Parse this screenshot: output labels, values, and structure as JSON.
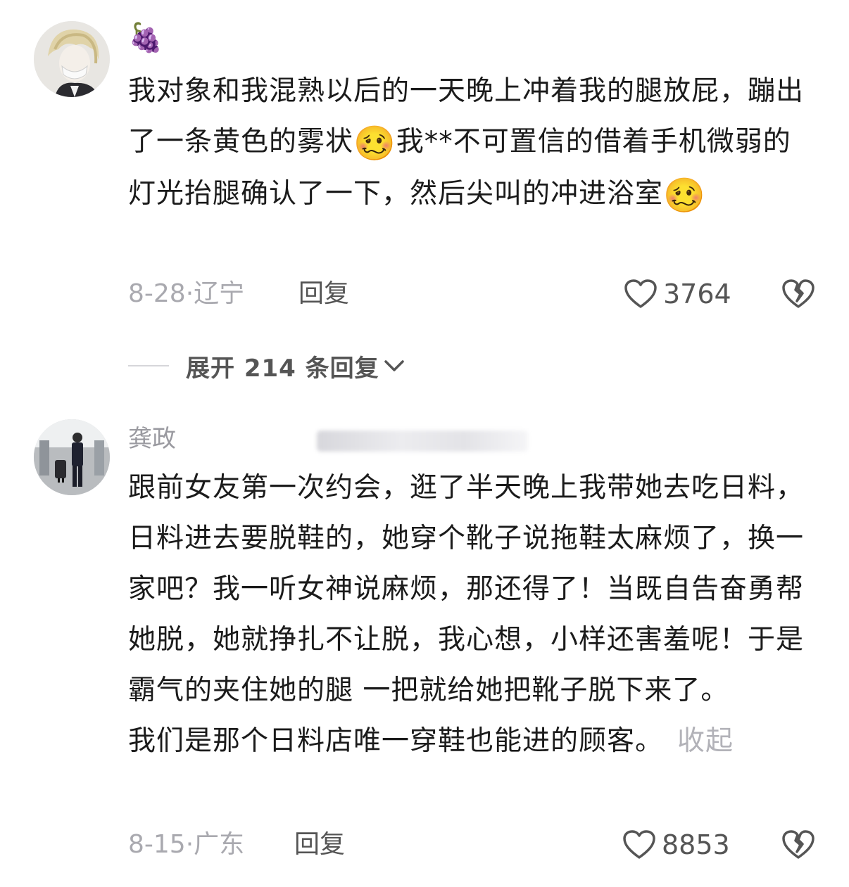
{
  "comments": [
    {
      "username": "",
      "badge_emoji": "🍇",
      "text_part1": "我对象和我混熟以后的一天晚上冲着我的腿放屁，蹦出了一条黄色的雾状",
      "emoji_inline": "🥴",
      "text_part2": "我**不可置信的借着手机微弱的灯光抬腿确认了一下，然后尖叫的冲进浴室",
      "emoji_end": "🥴",
      "time_location": "8-28·辽宁",
      "reply_label": "回复",
      "like_count": "3764",
      "expand_label": "展开 214 条回复"
    },
    {
      "username": "龚政",
      "text_main": "跟前女友第一次约会，逛了半天晚上我带她去吃日料，日料进去要脱鞋的，她穿个靴子说拖鞋太麻烦了，换一家吧？我一听女神说麻烦，那还得了！当既自告奋勇帮她脱，她就挣扎不让脱，我心想，小样还害羞呢！于是霸气的夹住她的腿 一把就给她把靴子脱下来了。",
      "text_last": "我们是那个日料店唯一穿鞋也能进的顾客。",
      "collapse_label": "收起",
      "time_location": "8-15·广东",
      "reply_label": "回复",
      "like_count": "8853"
    }
  ],
  "icons": {
    "like": "heart-outline-icon",
    "dislike": "broken-heart-icon",
    "expand": "chevron-down-icon"
  },
  "colors": {
    "text": "#1b1b1b",
    "meta": "#a9a9af",
    "icon": "#555555"
  }
}
